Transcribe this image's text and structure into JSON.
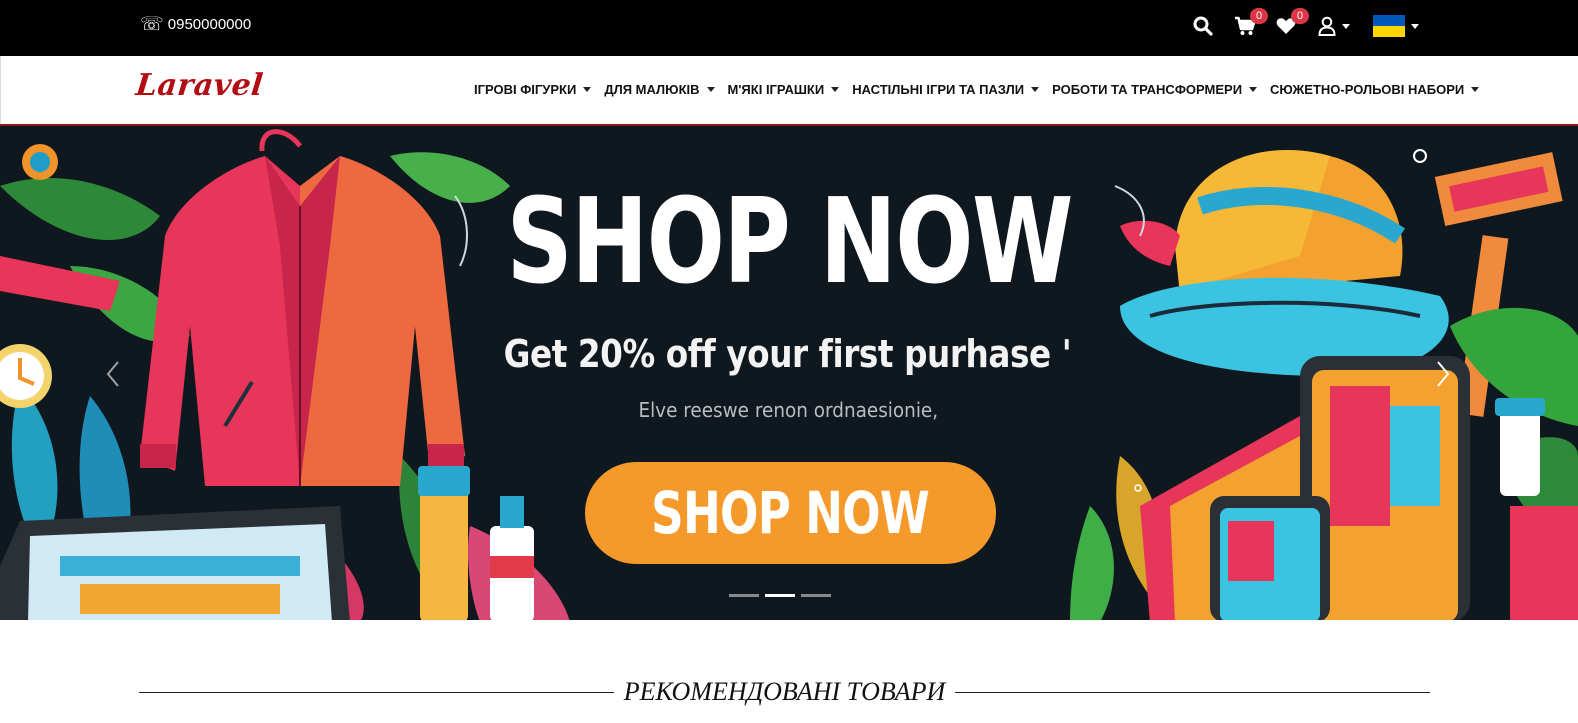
{
  "topbar": {
    "phone_icon": "phone-icon",
    "phone_glyph": "☏",
    "phone_number": "0950000000",
    "icons": [
      "search-icon",
      "cart-icon",
      "heart-icon",
      "user-icon"
    ],
    "cart_count": "0",
    "wishlist_count": "0",
    "language_flag": {
      "name": "ukraine-flag-icon",
      "colors": [
        "#0057b7",
        "#ffd700"
      ]
    }
  },
  "navbar": {
    "logo_text": "Laravel",
    "logo_color": "#b30d14",
    "menu": [
      {
        "label": "ІГРОВІ ФІГУРКИ"
      },
      {
        "label": "ДЛЯ МАЛЮКІВ"
      },
      {
        "label": "М'ЯКІ ІГРАШКИ"
      },
      {
        "label": "НАСТІЛЬНІ ІГРИ ТА ПАЗЛИ"
      },
      {
        "label": "РОБОТИ ТА ТРАНСФОРМЕРИ"
      },
      {
        "label": "СЮЖЕТНО-РОЛЬОВІ НАБОРИ"
      }
    ]
  },
  "hero": {
    "title": "SHOP NOW",
    "subtitle": "Get 20% off your first purhase '",
    "small_text": "Elve reeswe renon ordnaesionie,",
    "button_label": "SHOP NOW",
    "button_color": "#f5992b",
    "background_color": "#10181f",
    "slide_count": 3,
    "active_slide": 2
  },
  "section": {
    "title": "РЕКОМЕНДОВАНІ ТОВАРИ"
  }
}
